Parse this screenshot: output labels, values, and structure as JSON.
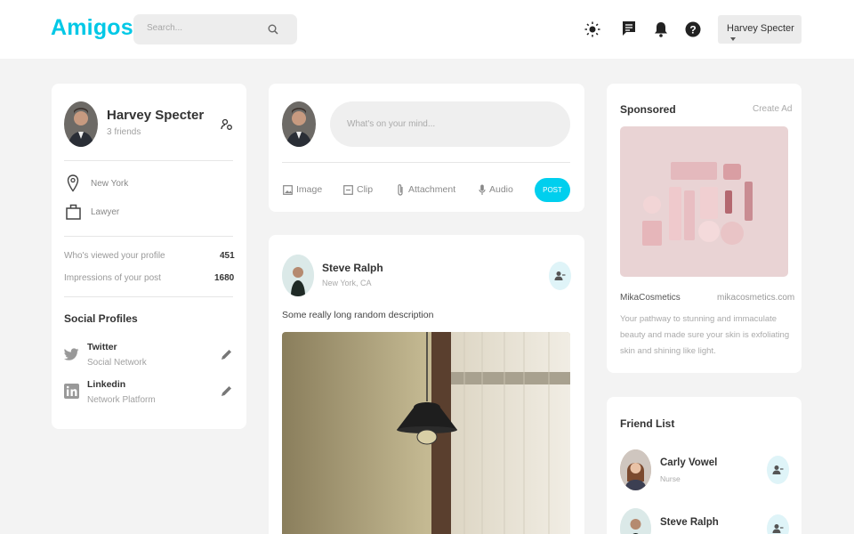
{
  "header": {
    "logo": "Amigos",
    "search_placeholder": "Search...",
    "user_menu": "Harvey Specter"
  },
  "profile": {
    "name": "Harvey Specter",
    "friends": "3 friends",
    "location": "New York",
    "occupation": "Lawyer",
    "stats": [
      {
        "label": "Who's viewed your profile",
        "value": "451"
      },
      {
        "label": "Impressions of your post",
        "value": "1680"
      }
    ],
    "social_title": "Social Profiles",
    "social": [
      {
        "name": "Twitter",
        "type": "Social Network"
      },
      {
        "name": "Linkedin",
        "type": "Network Platform"
      }
    ]
  },
  "composer": {
    "placeholder": "What's on your mind...",
    "actions": [
      "Image",
      "Clip",
      "Attachment",
      "Audio"
    ],
    "post_label": "POST"
  },
  "post": {
    "author": "Steve Ralph",
    "location": "New York, CA",
    "description": "Some really long random description"
  },
  "sponsored": {
    "title": "Sponsored",
    "create_ad": "Create Ad",
    "brand": "MikaCosmetics",
    "url": "mikacosmetics.com",
    "text": [
      "Your pathway to stunning and immaculate",
      "beauty and made sure your skin is exfoliating",
      "skin and shining like light."
    ]
  },
  "friend_list": {
    "title": "Friend List",
    "friends": [
      {
        "name": "Carly Vowel",
        "role": "Nurse"
      },
      {
        "name": "Steve Ralph",
        "role": ""
      }
    ]
  },
  "colors": {
    "accent": "#00c8e6",
    "background": "#f3f3f3"
  }
}
